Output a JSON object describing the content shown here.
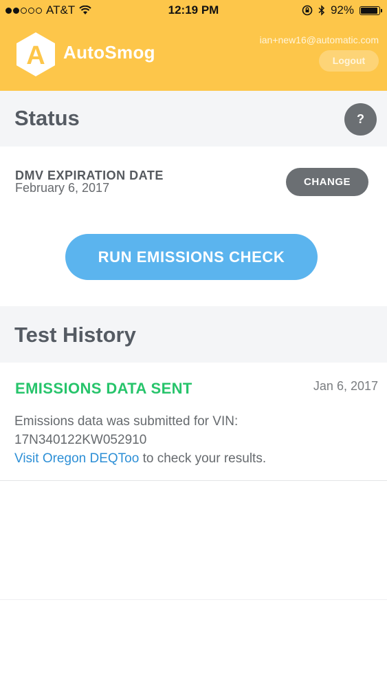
{
  "statusbar": {
    "carrier": "AT&T",
    "time": "12:19 PM",
    "battery": "92%",
    "battery_level": 0.92,
    "icons": [
      "signal-dots",
      "wifi-icon",
      "rotation-lock-icon",
      "bluetooth-icon",
      "battery-icon"
    ]
  },
  "header": {
    "brand": "AutoSmog",
    "logo_letter": "A",
    "email": "ian+new16@automatic.com",
    "logout_label": "Logout",
    "colors": {
      "background": "#fdc64a"
    }
  },
  "status_section": {
    "title": "Status",
    "help_label": "?"
  },
  "dmv": {
    "label": "DMV EXPIRATION DATE",
    "date": "February 6, 2017",
    "change_label": "CHANGE"
  },
  "run_button_label": "RUN EMISSIONS CHECK",
  "history_section": {
    "title": "Test History",
    "items": [
      {
        "status": "EMISSIONS DATA SENT",
        "date": "Jan 6, 2017",
        "message_line1": "Emissions data was submitted for VIN:",
        "vin": "17N340122KW052910",
        "link_text": "Visit Oregon DEQToo",
        "link_suffix": " to check your results."
      }
    ]
  },
  "colors": {
    "accent_blue": "#5bb4ee",
    "success_green": "#27c46b",
    "link_blue": "#2d8fd6",
    "dark_button": "#6b6f73"
  }
}
